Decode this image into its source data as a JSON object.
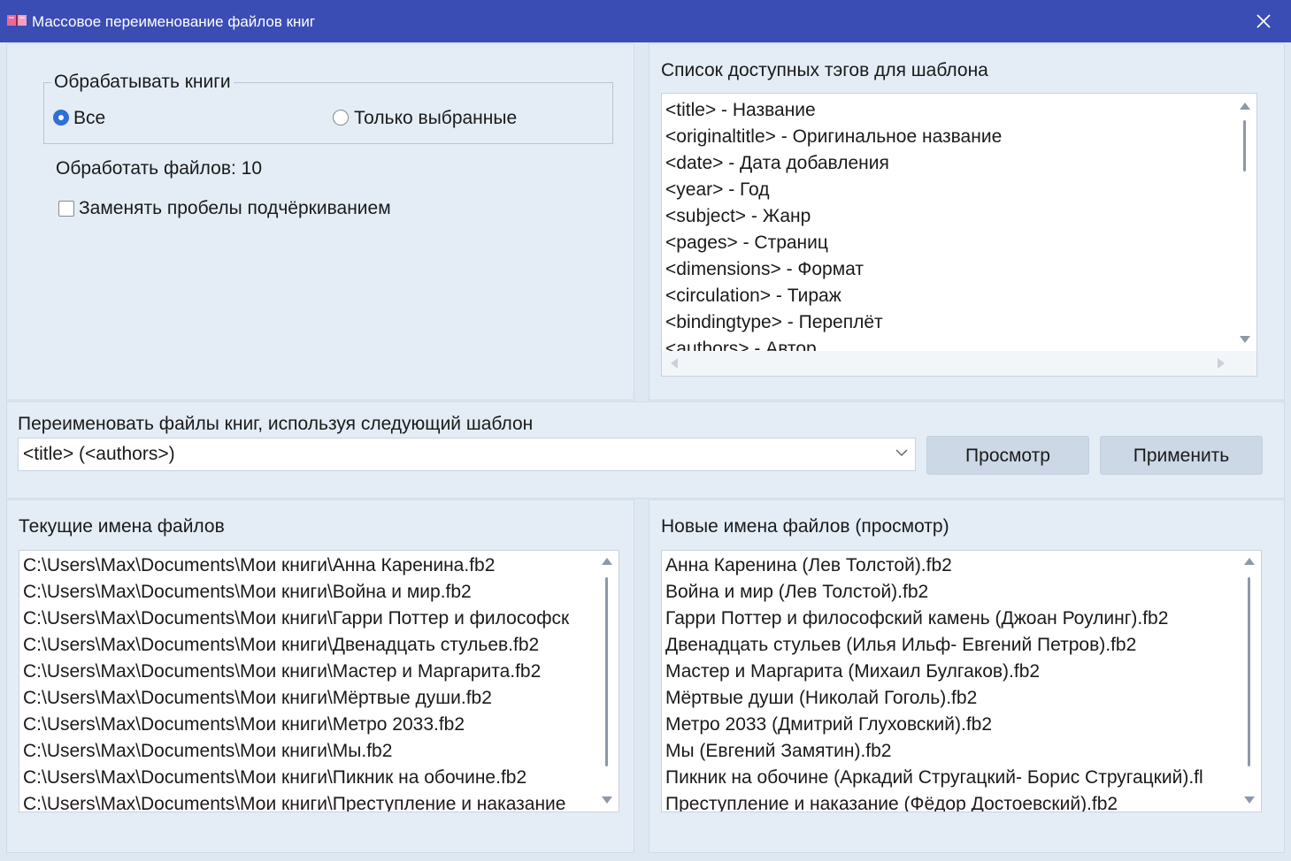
{
  "window": {
    "title": "Массовое переименование файлов книг",
    "icon": "book-icon",
    "accent": "#3a4db5"
  },
  "process": {
    "legend": "Обрабатывать книги",
    "option_all": "Все",
    "option_selected": "Только выбранные",
    "selected_option": "Все",
    "files_to_process": "Обработать файлов: 10",
    "replace_spaces_label": "Заменять пробелы подчёркиванием",
    "replace_spaces_checked": false
  },
  "tags": {
    "title": "Список доступных тэгов для шаблона",
    "items": [
      "<title> - Название",
      "<originaltitle> - Оригинальное название",
      "<date> - Дата добавления",
      "<year> - Год",
      "<subject> - Жанр",
      "<pages> - Страниц",
      "<dimensions> - Формат",
      "<circulation> - Тираж",
      "<bindingtype> - Переплёт",
      "<authors> - Автор"
    ]
  },
  "template": {
    "label": "Переименовать файлы книг, используя следующий шаблон",
    "value": "<title> (<authors>)",
    "preview_button": "Просмотр",
    "apply_button": "Применить"
  },
  "current_files": {
    "title": "Текущие имена файлов",
    "items": [
      "C:\\Users\\Max\\Documents\\Мои книги\\Анна Каренина.fb2",
      "C:\\Users\\Max\\Documents\\Мои книги\\Война и мир.fb2",
      "C:\\Users\\Max\\Documents\\Мои книги\\Гарри Поттер и философск",
      "C:\\Users\\Max\\Documents\\Мои книги\\Двенадцать стульев.fb2",
      "C:\\Users\\Max\\Documents\\Мои книги\\Мастер и Маргарита.fb2",
      "C:\\Users\\Max\\Documents\\Мои книги\\Мёртвые души.fb2",
      "C:\\Users\\Max\\Documents\\Мои книги\\Метро 2033.fb2",
      "C:\\Users\\Max\\Documents\\Мои книги\\Мы.fb2",
      "C:\\Users\\Max\\Documents\\Мои книги\\Пикник на обочине.fb2",
      "C:\\Users\\Max\\Documents\\Мои книги\\Преступление и наказание"
    ]
  },
  "new_files": {
    "title": "Новые имена файлов (просмотр)",
    "items": [
      "Анна Каренина (Лев Толстой).fb2",
      "Война и мир (Лев Толстой).fb2",
      "Гарри Поттер и философский камень (Джоан Роулинг).fb2",
      "Двенадцать стульев (Илья Ильф- Евгений Петров).fb2",
      "Мастер и Маргарита (Михаил Булгаков).fb2",
      "Мёртвые души (Николай Гоголь).fb2",
      "Метро 2033 (Дмитрий Глуховский).fb2",
      "Мы (Евгений Замятин).fb2",
      "Пикник на обочине (Аркадий Стругацкий- Борис Стругацкий).fl",
      "Преступление и наказание (Фёдор Достоевский).fb2"
    ]
  }
}
